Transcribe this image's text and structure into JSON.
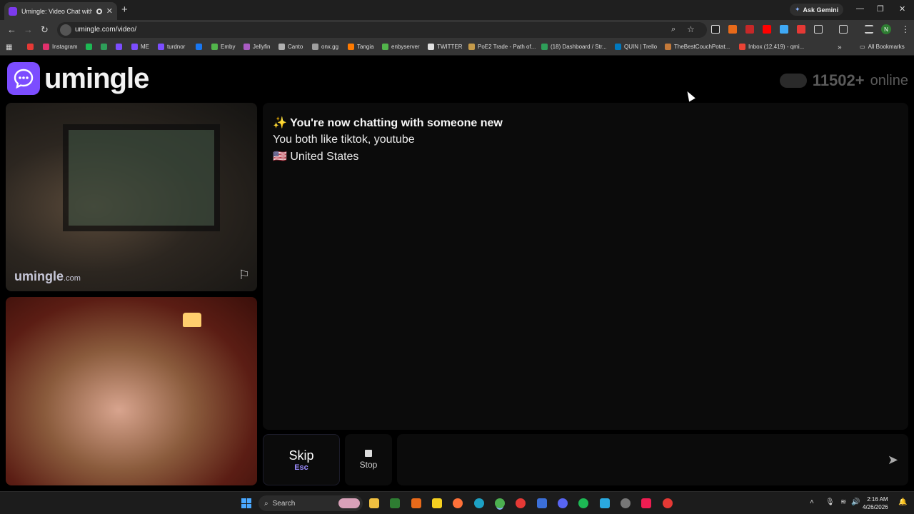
{
  "browser": {
    "tab_title": "Umingle: Video Chat with St",
    "new_tab": "+",
    "ask_gemini": "Ask Gemini",
    "url": "umingle.com/video/",
    "profile_initial": "N",
    "bookmarks": [
      {
        "label": "",
        "color": "#e53935"
      },
      {
        "label": "Instagram",
        "color": "#e1306c"
      },
      {
        "label": "",
        "color": "#1db954"
      },
      {
        "label": "",
        "color": "#2e9e59"
      },
      {
        "label": "",
        "color": "#7c4dff"
      },
      {
        "label": "ME",
        "color": "#7c4dff"
      },
      {
        "label": "turdnor",
        "color": "#7c4dff"
      },
      {
        "label": "",
        "color": "#1877f2"
      },
      {
        "label": "Emby",
        "color": "#52b54b"
      },
      {
        "label": "Jellyfin",
        "color": "#aa5cc3"
      },
      {
        "label": "Canto",
        "color": "#b0b0b0"
      },
      {
        "label": "onx.gg",
        "color": "#9e9e9e"
      },
      {
        "label": "Tangia",
        "color": "#ff7a00"
      },
      {
        "label": "enbyserver",
        "color": "#52b54b"
      },
      {
        "label": "TWITTER",
        "color": "#e0e0e0"
      },
      {
        "label": "PoE2 Trade - Path of...",
        "color": "#c49a4a"
      },
      {
        "label": "(18) Dashboard / Str...",
        "color": "#2e9e59"
      },
      {
        "label": "QUIN | Trello",
        "color": "#0079bf"
      },
      {
        "label": "TheBestCouchPotat...",
        "color": "#c47a3a"
      },
      {
        "label": "Inbox (12,419) - qmi...",
        "color": "#ea4335"
      }
    ],
    "all_bookmarks": "All Bookmarks"
  },
  "site": {
    "brand": "umingle",
    "online_count": "11502+",
    "online_label": "online",
    "watermark_main": "umingle",
    "watermark_domain": ".com",
    "accent": "#7c4dff"
  },
  "chat": {
    "title_emoji": "✨",
    "title": "You're now chatting with someone new",
    "interests": "You both like tiktok, youtube",
    "country_flag": "🇺🇸",
    "country": "United States"
  },
  "controls": {
    "skip_label": "Skip",
    "skip_key": "Esc",
    "stop_label": "Stop",
    "message_placeholder": ""
  },
  "taskbar": {
    "search_label": "Search",
    "time": "2:16 AM",
    "date": "4/26/2026"
  }
}
